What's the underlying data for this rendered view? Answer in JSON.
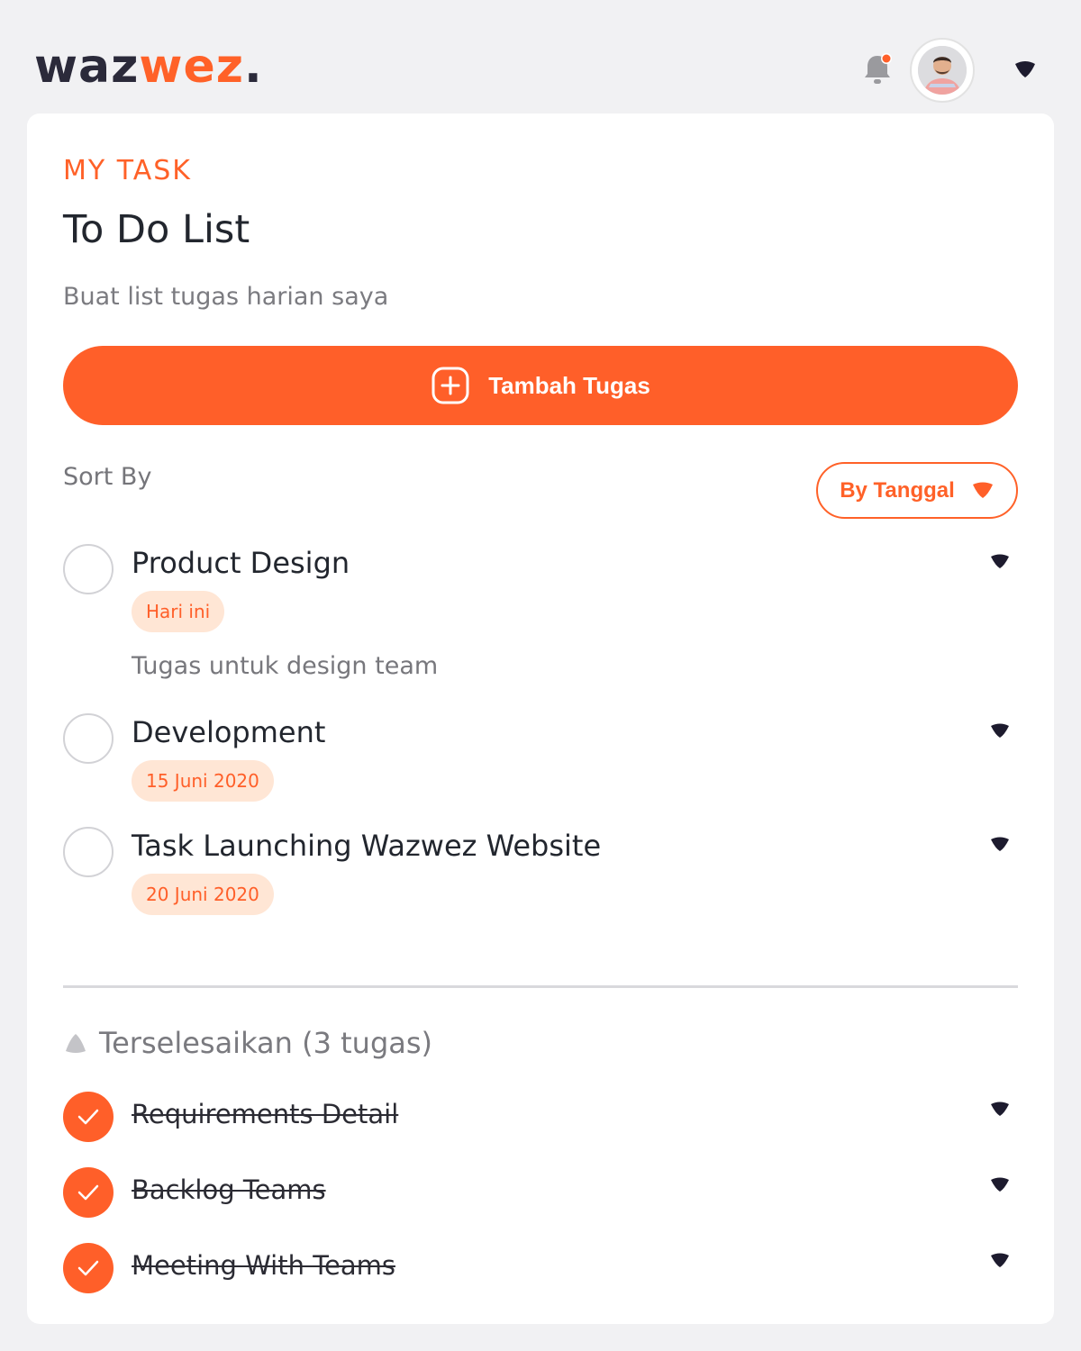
{
  "brand": {
    "part1": "waz",
    "part2": "wez",
    "dot": ".",
    "accent": "#ff6128",
    "dark": "#2b2a3a"
  },
  "header": {
    "notification_icon": "bell-icon",
    "notification_dot_color": "#ff5f29",
    "avatar_icon": "user-avatar",
    "menu_icon": "caret-down-icon"
  },
  "page": {
    "eyebrow": "MY TASK",
    "title": "To Do List",
    "subtitle": "Buat list tugas harian saya",
    "add_button": "Tambah Tugas",
    "sort_label": "Sort By",
    "sort_value": "By Tanggal"
  },
  "tasks": [
    {
      "title": "Product Design",
      "badge": "Hari ini",
      "description": "Tugas untuk design team"
    },
    {
      "title": "Development",
      "badge": "15 Juni 2020"
    },
    {
      "title": "Task Launching Wazwez Website",
      "badge": "20 Juni 2020"
    }
  ],
  "completed": {
    "header": "Terselesaikan (3 tugas)",
    "items": [
      {
        "title": "Requirements Detail"
      },
      {
        "title": "Backlog Teams"
      },
      {
        "title": "Meeting With Teams"
      }
    ]
  }
}
